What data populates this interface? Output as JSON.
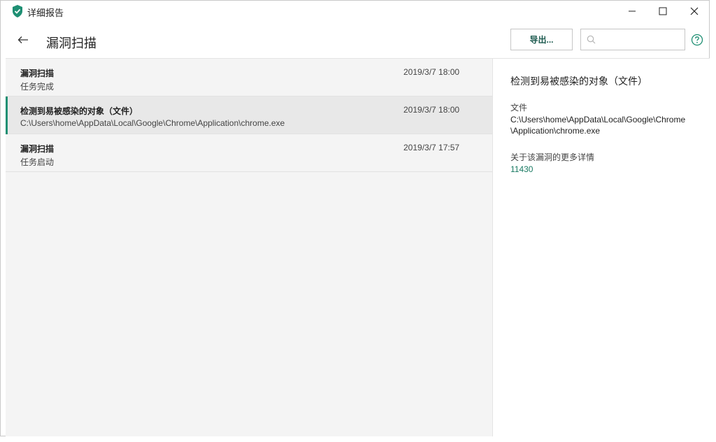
{
  "window": {
    "title": "详细报告"
  },
  "header": {
    "title": "漏洞扫描",
    "export_label": "导出...",
    "search_placeholder": ""
  },
  "list": {
    "items": [
      {
        "title": "漏洞扫描",
        "subtitle": "任务完成",
        "time": "2019/3/7 18:00",
        "selected": false
      },
      {
        "title": "检测到易被感染的对象（文件）",
        "subtitle": "C:\\Users\\home\\AppData\\Local\\Google\\Chrome\\Application\\chrome.exe",
        "time": "2019/3/7 18:00",
        "selected": true
      },
      {
        "title": "漏洞扫描",
        "subtitle": "任务启动",
        "time": "2019/3/7 17:57",
        "selected": false
      }
    ]
  },
  "detail": {
    "title": "检测到易被感染的对象（文件）",
    "file_label": "文件",
    "file_path_line1": "C:\\Users\\home\\AppData\\Local\\Google\\Chrome",
    "file_path_line2": "\\Application\\chrome.exe",
    "more_label": "关于该漏洞的更多详情",
    "more_link": "11430"
  },
  "colors": {
    "accent": "#1e8f73",
    "link": "#1a7a63",
    "list_bg": "#f4f4f4",
    "selected_bg": "#e8e8e8"
  },
  "icons": [
    "shield-icon",
    "minimize-icon",
    "maximize-icon",
    "close-icon",
    "back-arrow-icon",
    "search-icon",
    "help-icon"
  ]
}
